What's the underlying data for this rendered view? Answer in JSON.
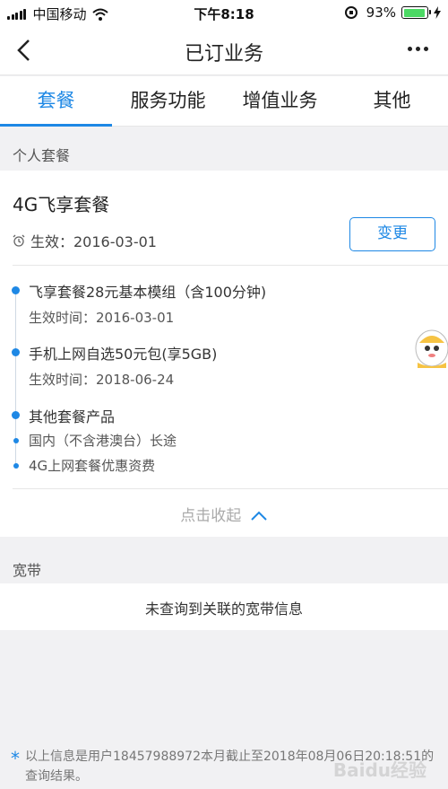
{
  "status_bar": {
    "carrier": "中国移动",
    "time": "下午8:18",
    "battery_percent": "93%",
    "battery_level": 0.93,
    "icons": [
      "signal-icon",
      "wifi-icon",
      "rotation-lock-icon",
      "battery-icon",
      "charging-icon"
    ]
  },
  "nav": {
    "title": "已订业务",
    "back_icon": "back-chevron-icon",
    "more_icon": "more-dots-icon"
  },
  "tabs": [
    {
      "label": "套餐",
      "active": true
    },
    {
      "label": "服务功能",
      "active": false
    },
    {
      "label": "增值业务",
      "active": false
    },
    {
      "label": "其他",
      "active": false
    }
  ],
  "personal_package": {
    "section_label": "个人套餐",
    "name": "4G飞享套餐",
    "effective": "生效：2016-03-01",
    "change_button": "变更",
    "items": [
      {
        "title": "飞享套餐28元基本模组（含100分钟)",
        "sub": "生效时间：2016-03-01"
      },
      {
        "title": "手机上网自选50元包(享5GB)",
        "sub": "生效时间：2018-06-24"
      },
      {
        "title": "其他套餐产品",
        "sub": ""
      }
    ],
    "other_products": [
      "国内（不含港澳台）长途",
      "4G上网套餐优惠资费"
    ],
    "collapse_label": "点击收起"
  },
  "broadband": {
    "section_label": "宽带",
    "message": "未查询到关联的宽带信息"
  },
  "footer": {
    "star": "*",
    "note": "以上信息是用户18457988972本月截止至2018年08月06日20:18:51的查询结果。",
    "watermark": "Baidu经验"
  },
  "colors": {
    "accent": "#1e88e5",
    "background": "#f1f1f3",
    "battery": "#4cd964"
  }
}
